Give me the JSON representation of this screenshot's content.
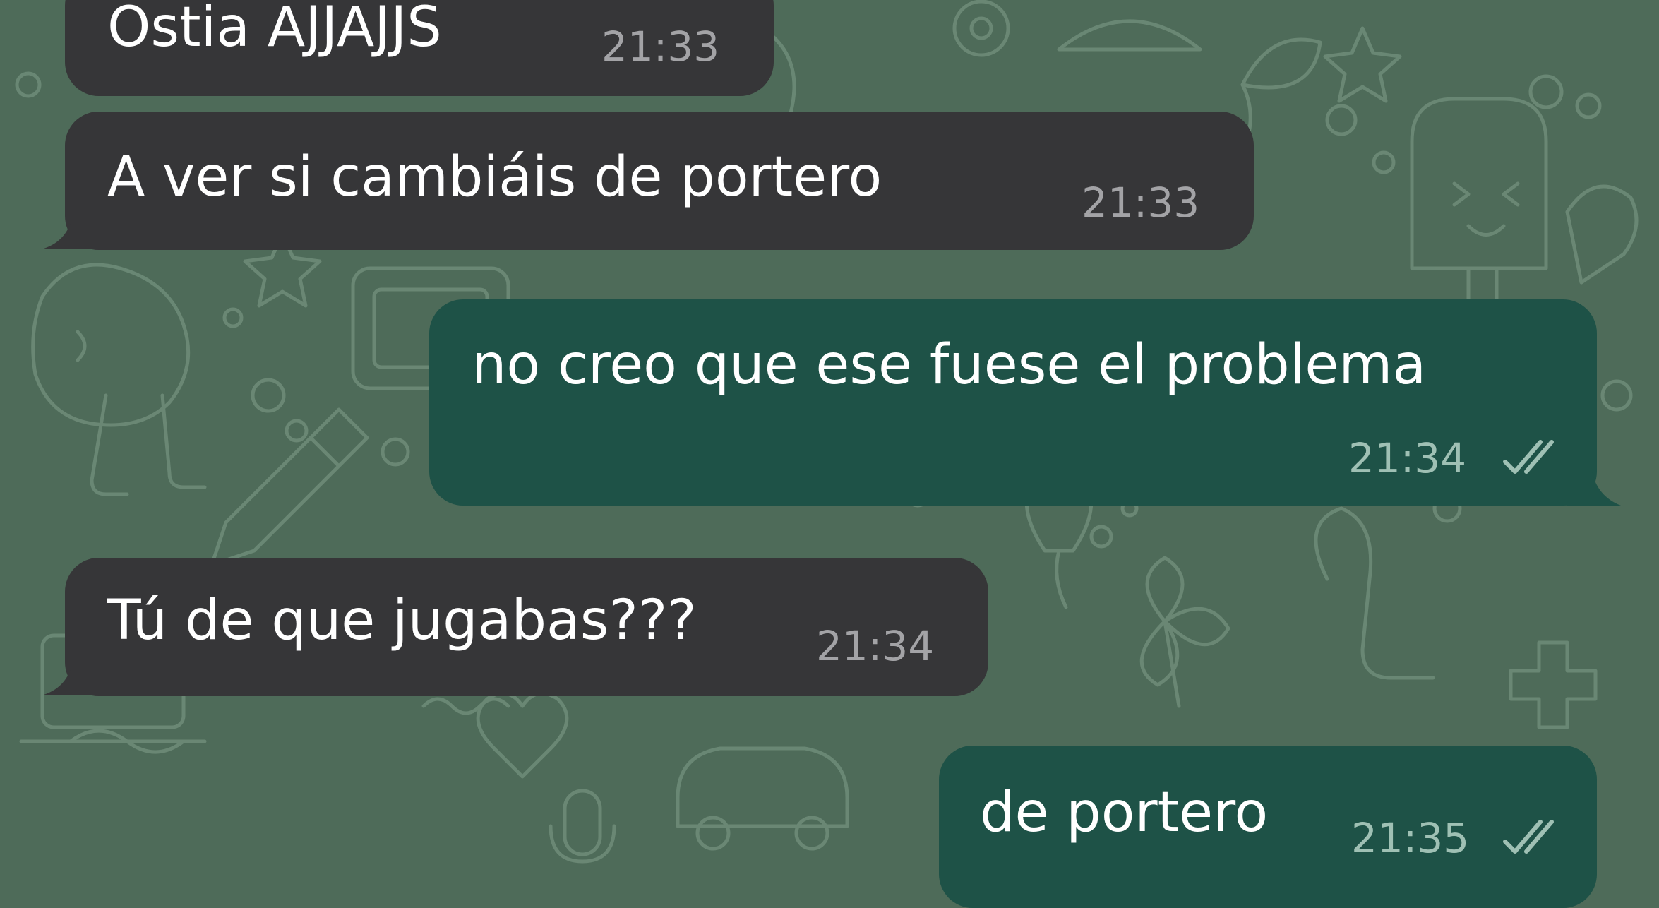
{
  "theme": {
    "wallpaper_color": "#4e6b59",
    "wallpaper_doodle_color": "#6f8c79",
    "incoming_bubble_color": "#363638",
    "outgoing_bubble_color": "#1e5247",
    "incoming_time_color": "#a3a3a6",
    "outgoing_time_color": "#9fc0b4",
    "read_ticks_color": "#9fc0b4"
  },
  "chat": {
    "messages": [
      {
        "direction": "incoming",
        "text": "Ostia AJJAJJS",
        "time": "21:33"
      },
      {
        "direction": "incoming",
        "text": "A ver si cambiáis de portero",
        "time": "21:33"
      },
      {
        "direction": "outgoing",
        "text": "no creo que ese fuese el problema",
        "time": "21:34",
        "status_icon": "double-check-read-icon"
      },
      {
        "direction": "incoming",
        "text": "Tú de que jugabas???",
        "time": "21:34"
      },
      {
        "direction": "outgoing",
        "text": "de portero",
        "time": "21:35",
        "status_icon": "double-check-read-icon"
      }
    ]
  }
}
